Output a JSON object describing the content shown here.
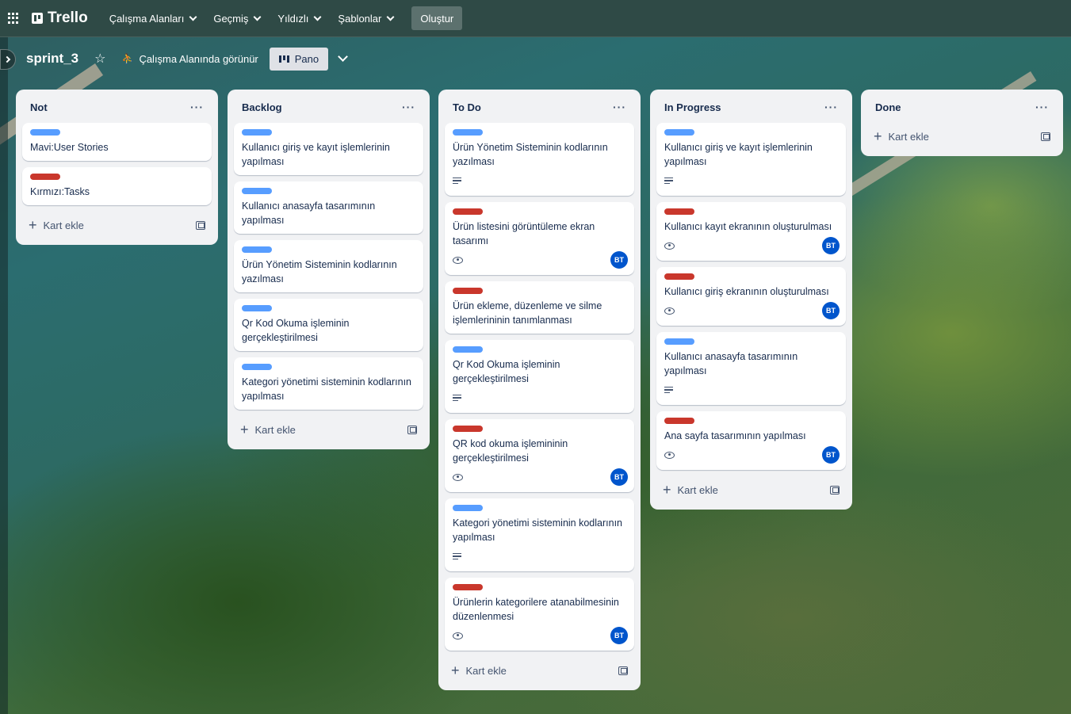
{
  "nav": {
    "workspaces": "Çalışma Alanları",
    "recent": "Geçmiş",
    "starred": "Yıldızlı",
    "templates": "Şablonlar",
    "create": "Oluştur",
    "logo": "Trello"
  },
  "board": {
    "title": "sprint_3",
    "visibility": "Çalışma Alanında görünür",
    "view": "Pano"
  },
  "add_card_label": "Kart ekle",
  "lists": [
    {
      "title": "Not",
      "cards": [
        {
          "label": "blue",
          "text": "Mavi:User Stories",
          "desc": false,
          "watch": false,
          "member": ""
        },
        {
          "label": "red",
          "text": "Kırmızı:Tasks",
          "desc": false,
          "watch": false,
          "member": ""
        }
      ]
    },
    {
      "title": "Backlog",
      "cards": [
        {
          "label": "blue",
          "text": "Kullanıcı giriş ve kayıt işlemlerinin yapılması",
          "desc": false,
          "watch": false,
          "member": ""
        },
        {
          "label": "blue",
          "text": "Kullanıcı anasayfa tasarımının yapılması",
          "desc": false,
          "watch": false,
          "member": ""
        },
        {
          "label": "blue",
          "text": "Ürün Yönetim Sisteminin kodlarının yazılması",
          "desc": false,
          "watch": false,
          "member": ""
        },
        {
          "label": "blue",
          "text": "Qr Kod Okuma işleminin gerçekleştirilmesi",
          "desc": false,
          "watch": false,
          "member": ""
        },
        {
          "label": "blue",
          "text": "Kategori yönetimi sisteminin kodlarının yapılması",
          "desc": false,
          "watch": false,
          "member": ""
        }
      ]
    },
    {
      "title": "To Do",
      "cards": [
        {
          "label": "blue",
          "text": "Ürün Yönetim Sisteminin kodlarının yazılması",
          "desc": true,
          "watch": false,
          "member": ""
        },
        {
          "label": "red",
          "text": "Ürün listesini görüntüleme ekran tasarımı",
          "desc": false,
          "watch": true,
          "member": "BT"
        },
        {
          "label": "red",
          "text": "Ürün ekleme, düzenleme ve silme işlemlerininin tanımlanması",
          "desc": false,
          "watch": false,
          "member": ""
        },
        {
          "label": "blue",
          "text": "Qr Kod Okuma işleminin gerçekleştirilmesi",
          "desc": true,
          "watch": false,
          "member": ""
        },
        {
          "label": "red",
          "text": "QR kod okuma işlemininin gerçekleştirilmesi",
          "desc": false,
          "watch": true,
          "member": "BT"
        },
        {
          "label": "blue",
          "text": "Kategori yönetimi sisteminin kodlarının yapılması",
          "desc": true,
          "watch": false,
          "member": ""
        },
        {
          "label": "red",
          "text": "Ürünlerin kategorilere atanabilmesinin düzenlenmesi",
          "desc": false,
          "watch": true,
          "member": "BT"
        }
      ]
    },
    {
      "title": "In Progress",
      "cards": [
        {
          "label": "blue",
          "text": "Kullanıcı giriş ve kayıt işlemlerinin yapılması",
          "desc": true,
          "watch": false,
          "member": ""
        },
        {
          "label": "red",
          "text": "Kullanıcı kayıt ekranının oluşturulması",
          "desc": false,
          "watch": true,
          "member": "BT"
        },
        {
          "label": "red",
          "text": "Kullanıcı giriş ekranının oluşturulması",
          "desc": false,
          "watch": true,
          "member": "BT"
        },
        {
          "label": "blue",
          "text": "Kullanıcı anasayfa tasarımının yapılması",
          "desc": true,
          "watch": false,
          "member": ""
        },
        {
          "label": "red",
          "text": "Ana sayfa tasarımının yapılması",
          "desc": false,
          "watch": true,
          "member": "BT"
        }
      ]
    },
    {
      "title": "Done",
      "cards": []
    }
  ]
}
